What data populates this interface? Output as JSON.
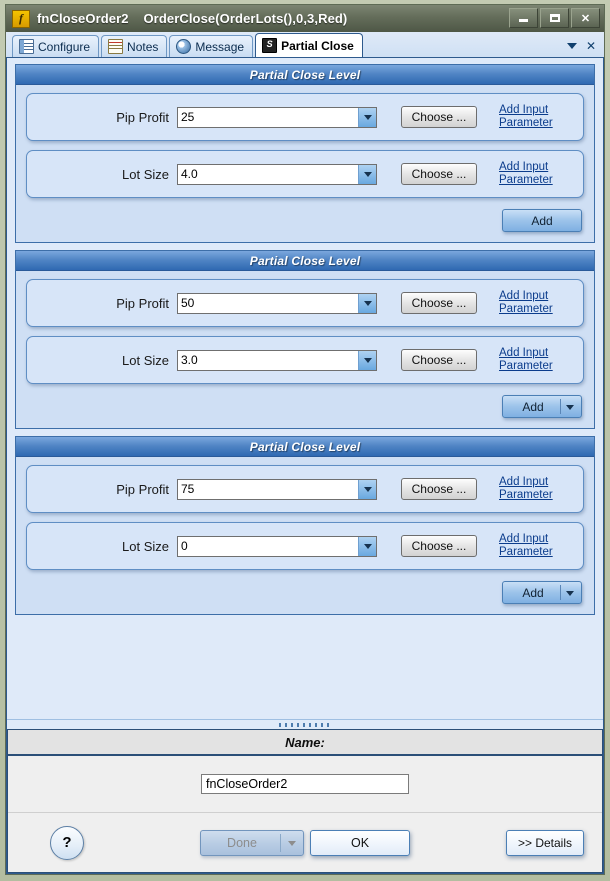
{
  "window": {
    "icon": "function-f-icon",
    "title": "fnCloseOrder2    OrderClose(OrderLots(),0,3,Red)",
    "controls": {
      "minimize": "minimize-icon",
      "maximize": "maximize-icon",
      "close": "✕"
    }
  },
  "tabs": [
    {
      "label": "Configure",
      "icon": "configure-icon",
      "active": false
    },
    {
      "label": "Notes",
      "icon": "notes-icon",
      "active": false
    },
    {
      "label": "Message",
      "icon": "message-icon",
      "active": false
    },
    {
      "label": "Partial Close",
      "icon": "partial-close-icon",
      "active": true
    }
  ],
  "tabstrip_right": {
    "dropdown": "chevron-down-icon",
    "close": "✕"
  },
  "labels": {
    "choose": "Choose ...",
    "add_input": "Add Input ",
    "parameter": "Parameter",
    "add": "Add",
    "pip_profit": "Pip Profit",
    "lot_size": "Lot Size"
  },
  "levels": [
    {
      "header": "Partial Close Level",
      "pip_profit": {
        "label": "Pip Profit",
        "value": "25"
      },
      "lot_size": {
        "label": "Lot Size",
        "value": "4.0"
      },
      "add_label": "Add",
      "add_split": false
    },
    {
      "header": "Partial Close Level",
      "pip_profit": {
        "label": "Pip Profit",
        "value": "50"
      },
      "lot_size": {
        "label": "Lot Size",
        "value": "3.0"
      },
      "add_label": "Add",
      "add_split": true
    },
    {
      "header": "Partial Close Level",
      "pip_profit": {
        "label": "Pip Profit",
        "value": "75"
      },
      "lot_size": {
        "label": "Lot Size",
        "value": "0"
      },
      "add_label": "Add",
      "add_split": true
    }
  ],
  "name_section": {
    "header": "Name:",
    "value": "fnCloseOrder2"
  },
  "footer": {
    "help": "?",
    "done": "Done",
    "ok": "OK",
    "details": ">> Details"
  },
  "colors": {
    "header_blue": "#2f69b2",
    "panel_bg": "#cfdff4",
    "page_bg": "#dfeaf9",
    "link": "#0b3c8c",
    "frame": "#b3bda0"
  }
}
